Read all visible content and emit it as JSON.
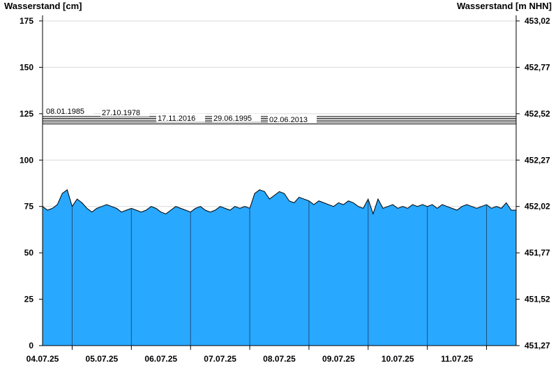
{
  "chart_data": {
    "type": "area",
    "ylabel_left": "Wasserstand [cm]",
    "ylabel_right": "Wasserstand [m NHN]",
    "ylim": [
      0,
      178
    ],
    "grid": true,
    "y_ticks_left": [
      {
        "value": 0,
        "label": "0"
      },
      {
        "value": 25,
        "label": "25"
      },
      {
        "value": 50,
        "label": "50"
      },
      {
        "value": 75,
        "label": "75"
      },
      {
        "value": 100,
        "label": "100"
      },
      {
        "value": 125,
        "label": "125"
      },
      {
        "value": 150,
        "label": "150"
      },
      {
        "value": 175,
        "label": "175"
      }
    ],
    "y_ticks_right": [
      {
        "value": 0,
        "label": "451,27"
      },
      {
        "value": 25,
        "label": "451,52"
      },
      {
        "value": 50,
        "label": "451,77"
      },
      {
        "value": 75,
        "label": "452,02"
      },
      {
        "value": 100,
        "label": "452,27"
      },
      {
        "value": 125,
        "label": "452,52"
      },
      {
        "value": 150,
        "label": "452,77"
      },
      {
        "value": 175,
        "label": "453,02"
      }
    ],
    "x_start": "03.07.25 12:00",
    "x_days": [
      "04.07.25",
      "05.07.25",
      "06.07.25",
      "07.07.25",
      "08.07.25",
      "09.07.25",
      "10.07.25",
      "11.07.25"
    ],
    "x_range_hours": [
      0,
      192
    ],
    "reference_levels": [
      {
        "label": "08.01.1985",
        "value": 123.5
      },
      {
        "label": "27.10.1978",
        "value": 122.5
      },
      {
        "label": "17.11.2016",
        "value": 121.5
      },
      {
        "label": "29.06.1995",
        "value": 120.5
      },
      {
        "label": "02.06.2013",
        "value": 119.5
      }
    ],
    "series": [
      {
        "color": "#29a8ff",
        "x": [
          0,
          2,
          4,
          6,
          8,
          10,
          12,
          14,
          16,
          18,
          20,
          22,
          24,
          26,
          28,
          30,
          32,
          34,
          36,
          38,
          40,
          42,
          44,
          46,
          48,
          50,
          52,
          54,
          56,
          58,
          60,
          62,
          64,
          66,
          68,
          70,
          72,
          74,
          76,
          78,
          80,
          82,
          84,
          86,
          88,
          90,
          92,
          94,
          96,
          98,
          100,
          102,
          104,
          106,
          108,
          110,
          112,
          114,
          116,
          118,
          120,
          122,
          124,
          126,
          128,
          130,
          132,
          134,
          136,
          138,
          140,
          142,
          144,
          146,
          148,
          150,
          152,
          154,
          156,
          158,
          160,
          162,
          164,
          166,
          168,
          170,
          172,
          174,
          176,
          178,
          180,
          182,
          184,
          186,
          188,
          190,
          192
        ],
        "values": [
          75,
          73,
          74,
          76,
          82,
          84,
          75,
          79,
          77,
          74,
          72,
          74,
          75,
          76,
          75,
          74,
          72,
          73,
          74,
          73,
          72,
          73,
          75,
          74,
          72,
          71,
          73,
          75,
          74,
          73,
          72,
          74,
          75,
          73,
          72,
          73,
          75,
          74,
          73,
          75,
          74,
          75,
          74,
          82,
          84,
          83,
          79,
          81,
          83,
          82,
          78,
          77,
          80,
          79,
          78,
          76,
          78,
          77,
          76,
          75,
          77,
          76,
          78,
          77,
          75,
          74,
          79,
          71,
          79,
          74,
          75,
          76,
          74,
          75,
          74,
          76,
          75,
          76,
          75,
          76,
          74,
          76,
          75,
          74,
          73,
          75,
          76,
          75,
          74,
          75,
          76,
          74,
          75,
          74,
          77,
          73,
          73
        ]
      }
    ]
  }
}
